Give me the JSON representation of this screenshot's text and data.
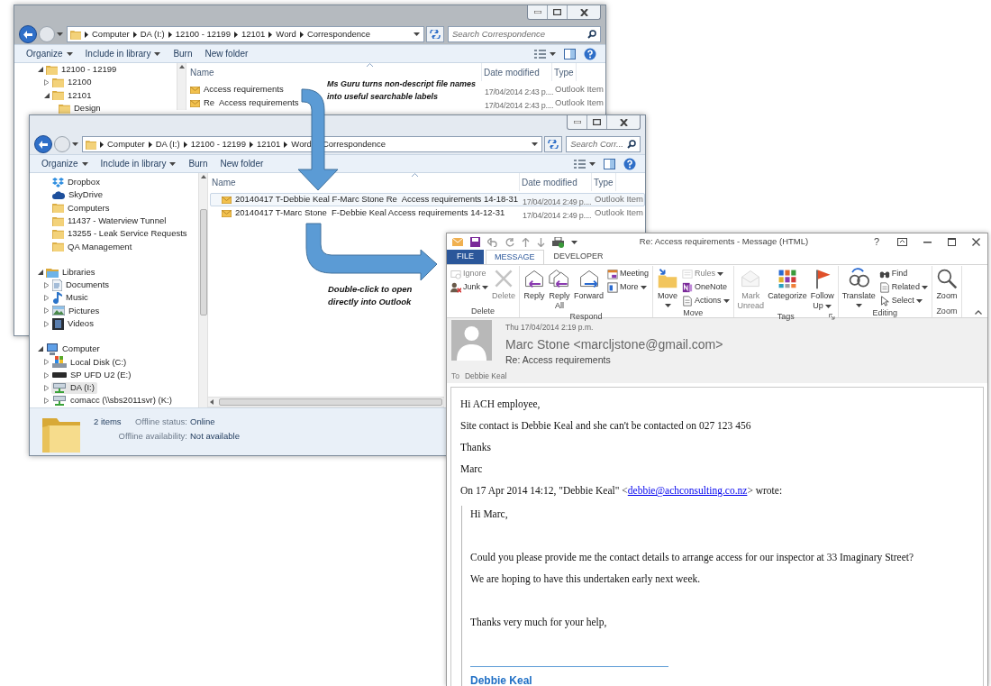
{
  "explorer_back": {
    "breadcrumb": [
      "Computer",
      "DA (I:)",
      "12100 - 12199",
      "12101",
      "Word",
      "Correspondence"
    ],
    "search_placeholder": "Search Correspondence",
    "toolbar": [
      {
        "label": "Organize",
        "dropdown": true
      },
      {
        "label": "Include in library",
        "dropdown": true
      },
      {
        "label": "Burn",
        "dropdown": false
      },
      {
        "label": "New folder",
        "dropdown": false
      }
    ],
    "nav_sections": [
      {
        "items": [
          {
            "label": "12100 - 12199",
            "kind": "folder",
            "expanded": true,
            "selected": false,
            "children": [
              {
                "label": "12100",
                "kind": "folder",
                "expanded": false,
                "selected": false
              },
              {
                "label": "12101",
                "kind": "folder",
                "expanded": true,
                "selected": false,
                "children": [
                  {
                    "label": "Design",
                    "kind": "folder",
                    "selected": false
                  }
                ]
              }
            ]
          }
        ]
      }
    ],
    "columns": [
      "Name",
      "Date modified",
      "Type"
    ],
    "files": [
      {
        "name": "Access requirements",
        "date": "17/04/2014 2:43 p....",
        "type": "Outlook Item",
        "selected": false
      },
      {
        "name": "Re  Access requirements",
        "date": "17/04/2014 2:43 p....",
        "type": "Outlook Item",
        "selected": false
      }
    ]
  },
  "explorer_front": {
    "breadcrumb": [
      "Computer",
      "DA (I:)",
      "12100 - 12199",
      "12101",
      "Word",
      "Correspondence"
    ],
    "search_placeholder": "Search Corr...",
    "toolbar": [
      {
        "label": "Organize",
        "dropdown": true
      },
      {
        "label": "Include in library",
        "dropdown": true
      },
      {
        "label": "Burn",
        "dropdown": false
      },
      {
        "label": "New folder",
        "dropdown": false
      }
    ],
    "nav_sections": [
      {
        "items": [
          {
            "label": "Dropbox",
            "kind": "dropbox",
            "selected": false
          },
          {
            "label": "SkyDrive",
            "kind": "skydrive",
            "selected": false
          },
          {
            "label": "Computers",
            "kind": "folder",
            "selected": false
          },
          {
            "label": "11437 - Waterview Tunnel",
            "kind": "folder",
            "selected": false
          },
          {
            "label": "13255 - Leak Service Requests",
            "kind": "folder",
            "selected": false
          },
          {
            "label": "QA Management",
            "kind": "folder",
            "selected": false
          }
        ]
      },
      {
        "items": [
          {
            "label": "Libraries",
            "kind": "library",
            "expanded": true,
            "selected": false,
            "children": [
              {
                "label": "Documents",
                "kind": "document",
                "expanded": false,
                "selected": false
              },
              {
                "label": "Music",
                "kind": "music",
                "expanded": false,
                "selected": false
              },
              {
                "label": "Pictures",
                "kind": "pictures",
                "expanded": false,
                "selected": false
              },
              {
                "label": "Videos",
                "kind": "videos",
                "expanded": false,
                "selected": false
              }
            ]
          }
        ]
      },
      {
        "items": [
          {
            "label": "Computer",
            "kind": "computer",
            "expanded": true,
            "selected": false,
            "children": [
              {
                "label": "Local Disk (C:)",
                "kind": "disk",
                "expanded": false,
                "selected": false
              },
              {
                "label": "SP UFD U2 (E:)",
                "kind": "usb",
                "expanded": false,
                "selected": false
              },
              {
                "label": "DA (I:)",
                "kind": "network",
                "expanded": false,
                "selected": true
              },
              {
                "label": "comacc (\\\\sbs2011svr) (K:)",
                "kind": "network",
                "expanded": false,
                "selected": false
              }
            ]
          }
        ]
      }
    ],
    "columns": [
      "Name",
      "Date modified",
      "Type"
    ],
    "files": [
      {
        "name": "20140417 T-Debbie Keal F-Marc Stone Re  Access requirements 14-18-31",
        "date": "17/04/2014 2:49 p....",
        "type": "Outlook Item",
        "selected": true
      },
      {
        "name": "20140417 T-Marc Stone  F-Debbie Keal Access requirements 14-12-31",
        "date": "17/04/2014 2:49 p....",
        "type": "Outlook Item",
        "selected": false
      }
    ],
    "details": {
      "count": "2 items",
      "status_label": "Offline status:",
      "status": "Online",
      "availability_label": "Offline availability:",
      "availability": "Not available"
    }
  },
  "annotations": [
    {
      "lines": [
        "Ms Guru turns non-descript file names",
        "into useful searchable labels"
      ]
    },
    {
      "lines": [
        "Double-click to open",
        "directly into Outlook"
      ]
    }
  ],
  "outlook": {
    "title": "Re: Access requirements - Message (HTML)",
    "help": "?",
    "tabs": [
      {
        "label": "FILE",
        "kind": "file",
        "selected": false
      },
      {
        "label": "MESSAGE",
        "kind": "tab",
        "selected": true
      },
      {
        "label": "DEVELOPER",
        "kind": "tab",
        "selected": false
      }
    ],
    "groups": [
      {
        "label": "Delete",
        "dialog_launcher": false,
        "items": [
          {
            "kind": "stack",
            "buttons": [
              {
                "label": "Ignore",
                "disabled": true,
                "dropdown": false
              },
              {
                "label": "Junk",
                "disabled": false,
                "dropdown": true
              }
            ]
          },
          {
            "kind": "large",
            "label": "Delete",
            "disabled": true,
            "dropdown": false
          }
        ]
      },
      {
        "label": "Respond",
        "dialog_launcher": false,
        "items": [
          {
            "kind": "large",
            "label": "Reply",
            "disabled": false,
            "dropdown": false
          },
          {
            "kind": "large",
            "label": "Reply\nAll",
            "disabled": false,
            "dropdown": false
          },
          {
            "kind": "large",
            "label": "Forward",
            "disabled": false,
            "dropdown": false
          },
          {
            "kind": "stack",
            "buttons": [
              {
                "label": "Meeting",
                "disabled": false,
                "dropdown": false
              },
              {
                "label": "More",
                "disabled": false,
                "dropdown": true
              }
            ]
          }
        ]
      },
      {
        "label": "Move",
        "dialog_launcher": false,
        "items": [
          {
            "kind": "large",
            "label": "Move",
            "disabled": false,
            "dropdown": true
          },
          {
            "kind": "stack",
            "buttons": [
              {
                "label": "Rules",
                "disabled": true,
                "dropdown": true
              },
              {
                "label": "OneNote",
                "disabled": false,
                "dropdown": false
              },
              {
                "label": "Actions",
                "disabled": false,
                "dropdown": true
              }
            ]
          }
        ]
      },
      {
        "label": "Tags",
        "dialog_launcher": true,
        "items": [
          {
            "kind": "large",
            "label": "Mark\nUnread",
            "disabled": true,
            "dropdown": false
          },
          {
            "kind": "large",
            "label": "Categorize",
            "disabled": false,
            "dropdown": false
          },
          {
            "kind": "large",
            "label": "Follow\nUp",
            "disabled": false,
            "dropdown": true
          }
        ]
      },
      {
        "label": "Editing",
        "dialog_launcher": false,
        "items": [
          {
            "kind": "large",
            "label": "Translate",
            "disabled": false,
            "dropdown": true
          },
          {
            "kind": "stack",
            "buttons": [
              {
                "label": "Find",
                "disabled": false,
                "dropdown": false
              },
              {
                "label": "Related",
                "disabled": false,
                "dropdown": true
              },
              {
                "label": "Select",
                "disabled": false,
                "dropdown": true
              }
            ]
          }
        ]
      },
      {
        "label": "Zoom",
        "dialog_launcher": false,
        "items": [
          {
            "kind": "large",
            "label": "Zoom",
            "disabled": false,
            "dropdown": false
          }
        ]
      }
    ],
    "message": {
      "date": "Thu 17/04/2014 2:19 p.m.",
      "from": "Marc Stone <marcljstone@gmail.com>",
      "subject": "Re: Access requirements",
      "to_label": "To",
      "to": "Debbie Keal",
      "body": [
        "Hi ACH employee,",
        "Site contact is Debbie Keal and she can't be contacted on 027 123 456",
        "Thanks",
        "Marc"
      ],
      "quote_intro": {
        "before": "On 17 Apr 2014 14:12, \"Debbie Keal\" <",
        "link": "debbie@achconsulting.co.nz",
        "after": "> wrote:"
      },
      "quote": [
        {
          "text": "Hi Marc,",
          "space_before": false
        },
        {
          "text": "Could you please provide me the contact details to arrange access for our inspector at 33 Imaginary Street?",
          "space_before": true
        },
        {
          "text": "We are hoping to have this undertaken early next week.",
          "space_before": false
        },
        {
          "text": "Thanks very much for your help,",
          "space_before": true
        }
      ],
      "signature": "Debbie Keal"
    }
  }
}
